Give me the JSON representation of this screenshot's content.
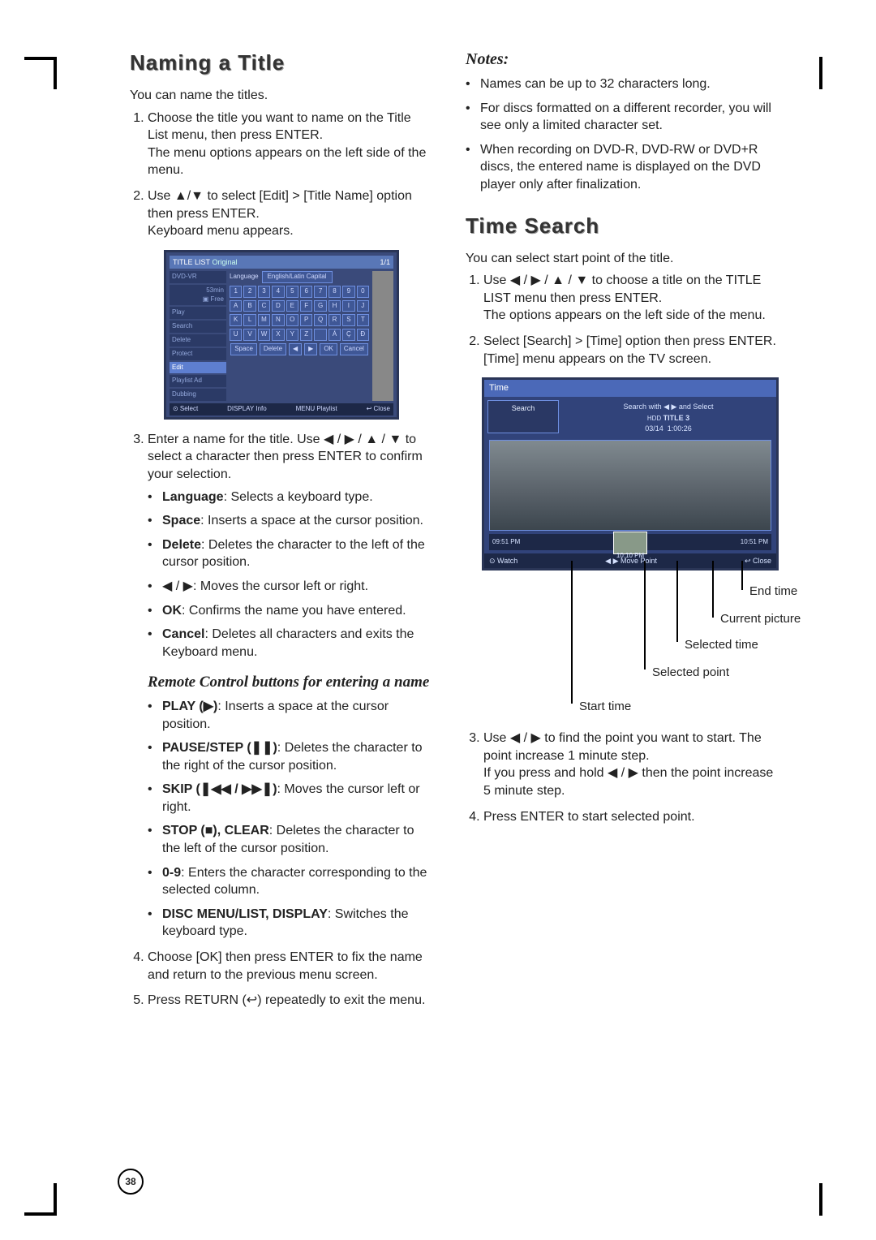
{
  "page_number": "38",
  "left": {
    "h_naming": "Naming a Title",
    "intro": "You can name the titles.",
    "step1": "Choose the title you want to name on the Title List menu, then press ENTER.\nThe menu options appears on the left side of the menu.",
    "step2": "Use ▲/▼ to select [Edit] > [Title Name] option then press ENTER.\nKeyboard menu appears.",
    "step3_lead": "Enter a name for the title. Use ◀ / ▶ / ▲ / ▼ to select a character then press ENTER to confirm your selection.",
    "b_language_t": "Language",
    "b_language": ": Selects a keyboard type.",
    "b_space_t": "Space",
    "b_space": ": Inserts a space at the cursor position.",
    "b_delete_t": "Delete",
    "b_delete": ": Deletes the character to the left of the cursor position.",
    "b_lr": "◀ / ▶: Moves the cursor left or right.",
    "b_ok_t": "OK",
    "b_ok": ": Confirms the name you have entered.",
    "b_cancel_t": "Cancel",
    "b_cancel": ": Deletes all characters and exits the Keyboard menu.",
    "sub_remote": "Remote Control buttons for entering a name",
    "r_play_t": "PLAY (▶)",
    "r_play": ": Inserts a space at the cursor position.",
    "r_pause_t": "PAUSE/STEP (❚❚)",
    "r_pause": ": Deletes the character to the right of the cursor position.",
    "r_skip_t": "SKIP (❚◀◀ / ▶▶❚)",
    "r_skip": ": Moves the cursor left or right.",
    "r_stop_t": "STOP (■), CLEAR",
    "r_stop": ": Deletes the character to the left of the cursor position.",
    "r_09_t": "0-9",
    "r_09": ": Enters the character corresponding to the selected column.",
    "r_disc_t": "DISC MENU/LIST, DISPLAY",
    "r_disc": ": Switches the keyboard type.",
    "step4": "Choose [OK] then press ENTER to fix the name and return to the previous menu screen.",
    "step5": "Press RETURN (↩) repeatedly to exit the menu."
  },
  "osd_kbd": {
    "title_left": "TITLE LIST",
    "title_mode": "Original",
    "title_right": "1/1",
    "disc": "DVD-VR",
    "free_a": "53min",
    "free_b": "▣ Free",
    "menu": [
      "Play",
      "Search",
      "Delete",
      "Protect",
      "Edit",
      "Playlist Ad",
      "Dubbing"
    ],
    "lang_label": "Language",
    "lang_opt": "English/Latin Capital",
    "row1": [
      "1",
      "2",
      "3",
      "4",
      "5",
      "6",
      "7",
      "8",
      "9",
      "0"
    ],
    "row2": [
      "A",
      "B",
      "C",
      "D",
      "E",
      "F",
      "G",
      "H",
      "I",
      "J"
    ],
    "row3": [
      "K",
      "L",
      "M",
      "N",
      "O",
      "P",
      "Q",
      "R",
      "S",
      "T"
    ],
    "row4": [
      "U",
      "V",
      "W",
      "X",
      "Y",
      "Z",
      "",
      "Á",
      "Ç",
      "Ð"
    ],
    "bot": [
      "Space",
      "Delete",
      "◀",
      "▶",
      "OK",
      "Cancel"
    ],
    "footer_l": "⊙ Select",
    "footer_m": "DISPLAY Info",
    "footer_m2": "MENU Playlist",
    "footer_r": "↩ Close",
    "page": "1/1"
  },
  "right": {
    "notes_h": "Notes:",
    "n1": "Names can be up to 32 characters long.",
    "n2": "For discs formatted on a different recorder, you will see only a limited character set.",
    "n3": "When recording on DVD-R, DVD-RW or DVD+R discs, the entered name is displayed on the DVD player only after finalization.",
    "h_time": "Time Search",
    "t_intro": "You can select start point of the title.",
    "t1": "Use ◀ / ▶ / ▲ / ▼ to choose a title on the TITLE LIST menu then press ENTER.\nThe options appears on the left side of the menu.",
    "t2": "Select [Search] > [Time] option then press ENTER.\n[Time] menu appears on the TV screen.",
    "t3": "Use ◀ / ▶ to find the point you want to start. The point increase 1 minute step.\nIf you press and hold ◀ / ▶ then the point increase 5 minute step.",
    "t4": "Press ENTER to start selected point."
  },
  "osd_time": {
    "hdr": "Time",
    "side": "Search",
    "hint": "Search with ◀ ▶ and Select",
    "title": "TITLE 3",
    "date": "03/14",
    "dur": "1:00:26",
    "t_left": "09:51 PM",
    "t_mid": "10:10 PM",
    "t_right": "10:51 PM",
    "bot_l": "⊙ Watch",
    "bot_m": "◀ ▶ Move Point",
    "bot_r": "↩ Close"
  },
  "annot": {
    "end": "End time",
    "cur": "Current picture",
    "sel_t": "Selected time",
    "sel_p": "Selected point",
    "start": "Start time"
  }
}
